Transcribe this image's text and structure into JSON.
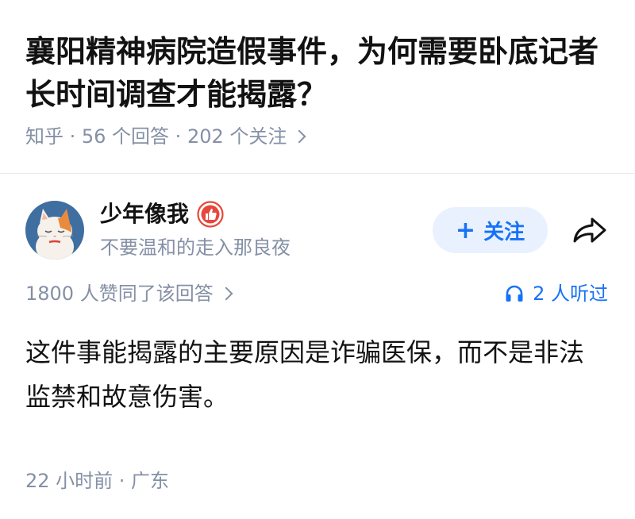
{
  "question": {
    "title": "襄阳精神病院造假事件，为何需要卧底记者长时间调查才能揭露？",
    "meta": "知乎 · 56 个回答 · 202 个关注"
  },
  "author": {
    "name": "少年像我",
    "bio": "不要温和的走入那良夜",
    "avatar_icon": "cat-avatar",
    "badge_icon": "thumbs-up-badge-icon"
  },
  "actions": {
    "follow_plus": "+",
    "follow_label": "关注",
    "share_icon": "share-arrow-icon"
  },
  "stats": {
    "votes": "1800 人赞同了该回答",
    "listened": "2 人听过"
  },
  "answer": {
    "body": "这件事能揭露的主要原因是诈骗医保，而不是非法监禁和故意伤害。",
    "meta": "22 小时前 · 广东"
  },
  "colors": {
    "accent": "#1772f6",
    "follow_bg": "#e9f1ff",
    "muted": "#8590a6",
    "badge": "#e6473b"
  }
}
